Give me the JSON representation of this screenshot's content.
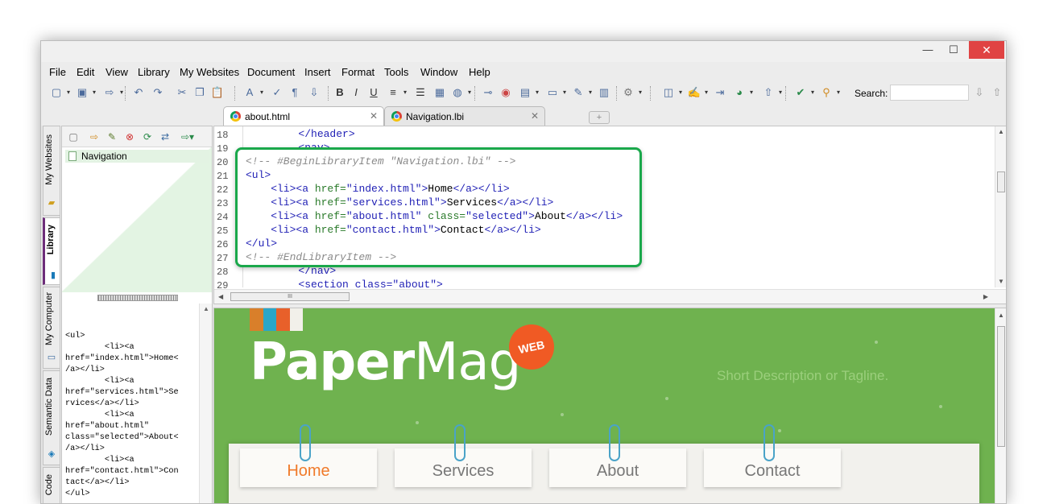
{
  "window": {
    "controls": {
      "minimize": "—",
      "maximize": "☐",
      "close": "✕"
    }
  },
  "menu": [
    "File",
    "Edit",
    "View",
    "Library",
    "My Websites",
    "Document",
    "Insert",
    "Format",
    "Tools",
    "Window",
    "Help"
  ],
  "toolbar": {
    "search_label": "Search:",
    "search_value": ""
  },
  "tabs": [
    {
      "label": "about.html",
      "active": true
    },
    {
      "label": "Navigation.lbi",
      "active": false
    }
  ],
  "side_tabs": [
    "My Websites",
    "Library",
    "My Computer",
    "Semantic Data",
    "Code"
  ],
  "library": {
    "items": [
      "Navigation"
    ],
    "preview_code": "<ul>\n        <li><a\nhref=\"index.html\">Home<\n/a></li>\n        <li><a\nhref=\"services.html\">Se\nrvices</a></li>\n        <li><a\nhref=\"about.html\"\nclass=\"selected\">About<\n/a></li>\n        <li><a\nhref=\"contact.html\">Con\ntact</a></li>\n</ul>"
  },
  "editor": {
    "line_numbers": [
      "18",
      "19",
      "20",
      "21",
      "22",
      "23",
      "24",
      "25",
      "26",
      "27",
      "28",
      "29"
    ],
    "top_lines": [
      {
        "text": "        </header>"
      },
      {
        "text": "        <nav>"
      }
    ],
    "bottom_lines": [
      {
        "text": "        </nav>"
      },
      {
        "text": "        <section class=\"about\">"
      }
    ],
    "library_block": {
      "begin_comment": "<!-- #BeginLibraryItem \"Navigation.lbi\" -->",
      "ul_open": "<ul>",
      "items": [
        {
          "href": "index.html",
          "class": "",
          "text": "Home"
        },
        {
          "href": "services.html",
          "class": "",
          "text": "Services"
        },
        {
          "href": "about.html",
          "class": "selected",
          "text": "About"
        },
        {
          "href": "contact.html",
          "class": "",
          "text": "Contact"
        }
      ],
      "ul_close": "</ul>",
      "end_comment": "<!-- #EndLibraryItem -->"
    }
  },
  "preview": {
    "logo_bold": "Paper",
    "logo_light": "Mag",
    "badge": "WEB",
    "tagline": "Short Description or Tagline.",
    "nav": [
      {
        "label": "Home",
        "selected": true
      },
      {
        "label": "Services",
        "selected": false
      },
      {
        "label": "About",
        "selected": false
      },
      {
        "label": "Contact",
        "selected": false
      }
    ],
    "colors": {
      "background": "#6fb24f",
      "accent": "#f07a2a",
      "badge": "#f05a24",
      "clip": "#4aa3c8",
      "bars": [
        "#d97f2a",
        "#2aa6c8",
        "#e8602a",
        "#f2f0ea"
      ]
    }
  }
}
